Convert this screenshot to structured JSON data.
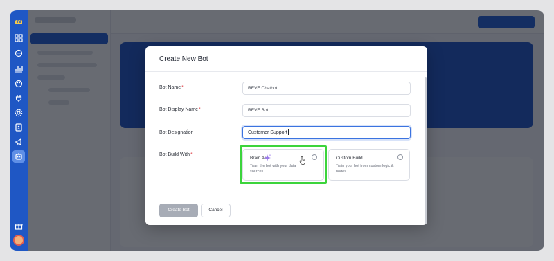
{
  "modal": {
    "title": "Create New Bot",
    "fields": {
      "bot_name": {
        "label": "Bot Name",
        "value": "REVE Chatbot",
        "required": true
      },
      "display_name": {
        "label": "Bot Display Name",
        "value": "REVE Bot",
        "required": true
      },
      "designation": {
        "label": "Bot Designation",
        "value": "Customer Support",
        "required": false
      },
      "build_with": {
        "label": "Bot Build With",
        "required": true
      }
    },
    "required_marker": "*",
    "build_options": [
      {
        "title": "Brain AI",
        "description": "Train the bot with your data sources.",
        "icon": "sparkle-icon",
        "selected": false
      },
      {
        "title": "Custom Build",
        "description": "Train your bot from custom logic & nodes",
        "selected": false
      }
    ],
    "buttons": {
      "create": "Create Bot",
      "cancel": "Cancel"
    }
  },
  "colors": {
    "accent": "#2460d6",
    "highlight": "#3cd43c",
    "required": "#e0484e",
    "disabled_button": "#a7acb6"
  },
  "rail_icons": [
    "logo-icon",
    "dashboard-icon",
    "chat-icon",
    "analytics-icon",
    "palette-icon",
    "plug-icon",
    "settings-icon",
    "contacts-icon",
    "megaphone-icon",
    "bot-icon",
    "gift-icon",
    "avatar"
  ]
}
